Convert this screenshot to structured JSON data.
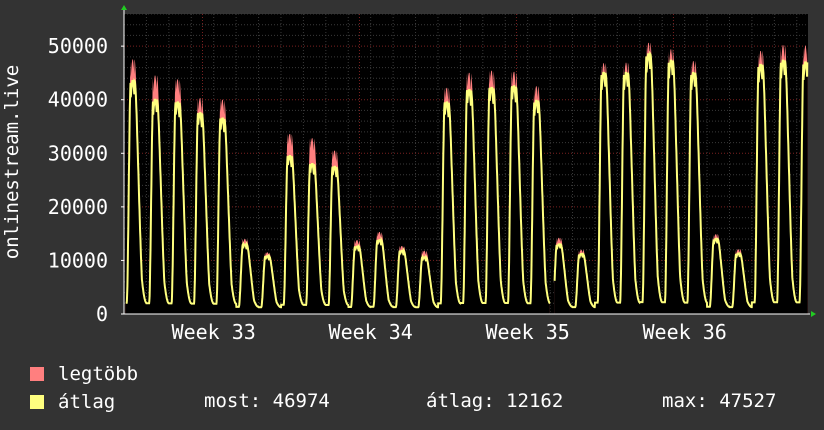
{
  "chart_data": {
    "type": "area",
    "ylabel": "onlinestream.live",
    "ylim": [
      0,
      56000
    ],
    "yticks": [
      0,
      10000,
      20000,
      30000,
      40000,
      50000
    ],
    "xlabels": [
      {
        "label": "Week 33",
        "day": 4
      },
      {
        "label": "Week 34",
        "day": 11
      },
      {
        "label": "Week 35",
        "day": 18
      },
      {
        "label": "Week 36",
        "day": 25
      }
    ],
    "x_days": [
      0,
      30.5
    ],
    "grid": true,
    "daily_peaks": {
      "max": [
        47500,
        44500,
        43800,
        40300,
        40000,
        14000,
        11500,
        33600,
        32800,
        30500,
        13800,
        15300,
        12700,
        11800,
        42200,
        45000,
        45400,
        45200,
        42500,
        14200,
        12000,
        46800,
        46900,
        50600,
        49400,
        47200,
        14900,
        12100,
        49100,
        50200,
        50100
      ],
      "mean": [
        43500,
        40000,
        39500,
        37500,
        36500,
        13000,
        10800,
        29500,
        28000,
        27500,
        12600,
        13800,
        11800,
        10600,
        39500,
        41800,
        42200,
        42500,
        39800,
        13000,
        11200,
        45000,
        45000,
        48500,
        47300,
        45000,
        14000,
        11300,
        46500,
        47300,
        46974
      ]
    },
    "gap": [
      19.0,
      19.2
    ],
    "series": [
      {
        "name": "legtöbb",
        "color": "#ff7f7f"
      },
      {
        "name": "átlag",
        "color": "#ffff7f"
      }
    ]
  },
  "legend": {
    "max_label": "legtöbb",
    "avg_label": "átlag",
    "now_text": "most: 46974",
    "avg_text": "átlag: 12162",
    "max_text": "max: 47527"
  }
}
